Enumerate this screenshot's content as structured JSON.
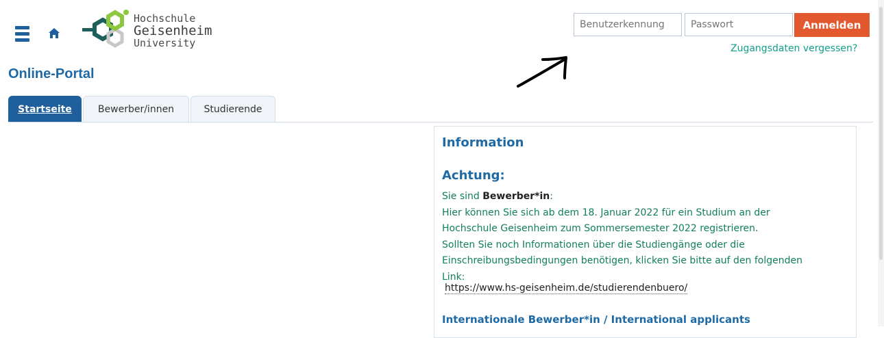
{
  "header": {
    "logo": {
      "line1": "Hochschule",
      "line2": "Geisenheim",
      "line3": "University"
    },
    "portal_title": "Online-Portal"
  },
  "login": {
    "username_placeholder": "Benutzerkennung",
    "password_placeholder": "Passwort",
    "login_label": "Anmelden",
    "forgot_label": "Zugangsdaten vergessen?"
  },
  "tabs": [
    {
      "label": "Startseite",
      "active": true
    },
    {
      "label": "Bewerber/innen",
      "active": false
    },
    {
      "label": "Studierende",
      "active": false
    }
  ],
  "info": {
    "title": "Information",
    "heading": "Achtung:",
    "intro_prefix": "Sie sind ",
    "intro_bold": "Bewerber*in",
    "intro_suffix": ":",
    "lines": [
      "Hier können Sie sich ab dem 18. Januar 2022 für ein Studium an der",
      "Hochschule Geisenheim zum Sommersemester 2022 registrieren.",
      "Sollten Sie noch Informationen über die Studiengänge oder die",
      "Einschreibungsbedingungen benötigen, klicken Sie bitte auf den folgenden",
      "Link:"
    ],
    "link": "https://www.hs-geisenheim.de/studierendenbuero/",
    "international_heading": "Internationale Bewerber*in / International applicants"
  },
  "colors": {
    "accent_blue": "#1f6aa5",
    "button_orange": "#e2592f",
    "text_green": "#127f5c",
    "link_teal": "#13a089"
  },
  "icons": [
    "menu-icon",
    "home-icon",
    "arrow-annotation"
  ]
}
